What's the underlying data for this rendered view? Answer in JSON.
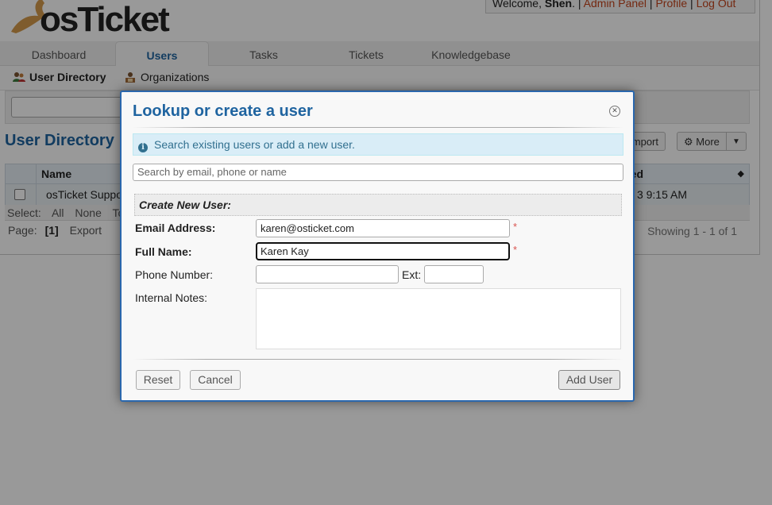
{
  "app": {
    "logo_text": "osTicket",
    "welcome_prefix": "Welcome, ",
    "user_name": "Shen",
    "welcome_sep": ".",
    "links": [
      "Admin Panel",
      "Profile",
      "Log Out"
    ]
  },
  "nav": {
    "tabs": [
      {
        "label": "Dashboard"
      },
      {
        "label": "Users"
      },
      {
        "label": "Tasks"
      },
      {
        "label": "Tickets"
      },
      {
        "label": "Knowledgebase"
      }
    ],
    "subnav": [
      {
        "label": "User Directory"
      },
      {
        "label": "Organizations"
      }
    ]
  },
  "directory": {
    "title": "User Directory",
    "import_label": "Import",
    "more_label": "More",
    "columns": [
      "Name",
      "ted"
    ],
    "rows": [
      {
        "name": "osTicket Suppo",
        "updated": "3 9:15 AM"
      }
    ],
    "select": {
      "label": "Select:",
      "all": "All",
      "none": "None",
      "toggle": "To"
    },
    "pagination": {
      "label": "Page:",
      "current": "[1]",
      "export": "Export",
      "showing": "Showing 1 - 1 of 1"
    }
  },
  "dialog": {
    "title": "Lookup or create a user",
    "info": "Search existing users or add a new user.",
    "search_placeholder": "Search by email, phone or name",
    "section_title": "Create New User:",
    "email_label": "Email Address:",
    "email_value": "karen@osticket.com",
    "name_label": "Full Name:",
    "name_value": "Karen Kay",
    "phone_label": "Phone Number:",
    "ext_label": "Ext:",
    "notes_label": "Internal Notes:",
    "required_marker": "*",
    "reset_label": "Reset",
    "cancel_label": "Cancel",
    "add_label": "Add User"
  },
  "colors": {
    "accent": "#1f64a0",
    "link": "#c2431b",
    "dialog_border": "#2a67ad",
    "info_bg": "#d9edf7",
    "required": "#d9534f"
  },
  "icons": [
    "user-directory-icon",
    "organizations-icon",
    "close-icon",
    "info-icon",
    "gear-icon",
    "caret-down-icon",
    "sort-icon"
  ]
}
